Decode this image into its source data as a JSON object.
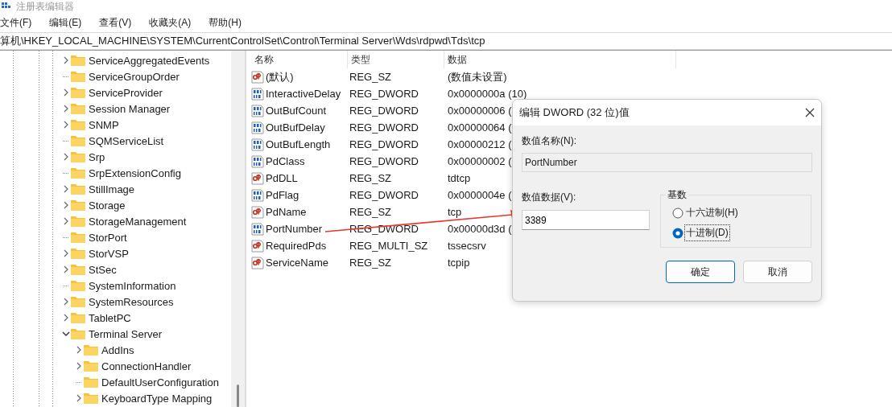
{
  "window": {
    "title": "注册表编辑器"
  },
  "menu": [
    "文件(F)",
    "编辑(E)",
    "查看(V)",
    "收藏夹(A)",
    "帮助(H)"
  ],
  "address": "算机\\HKEY_LOCAL_MACHINE\\SYSTEM\\CurrentControlSet\\Control\\Terminal Server\\Wds\\rdpwd\\Tds\\tcp",
  "tree": [
    {
      "label": "ServiceAggregatedEvents",
      "has_subkeys": true,
      "expanded": false
    },
    {
      "label": "ServiceGroupOrder",
      "has_subkeys": false
    },
    {
      "label": "ServiceProvider",
      "has_subkeys": true,
      "expanded": false
    },
    {
      "label": "Session Manager",
      "has_subkeys": true,
      "expanded": false
    },
    {
      "label": "SNMP",
      "has_subkeys": true,
      "expanded": false
    },
    {
      "label": "SQMServiceList",
      "has_subkeys": false
    },
    {
      "label": "Srp",
      "has_subkeys": true,
      "expanded": false
    },
    {
      "label": "SrpExtensionConfig",
      "has_subkeys": false
    },
    {
      "label": "StillImage",
      "has_subkeys": true,
      "expanded": false
    },
    {
      "label": "Storage",
      "has_subkeys": true,
      "expanded": false
    },
    {
      "label": "StorageManagement",
      "has_subkeys": true,
      "expanded": false
    },
    {
      "label": "StorPort",
      "has_subkeys": false
    },
    {
      "label": "StorVSP",
      "has_subkeys": true,
      "expanded": false
    },
    {
      "label": "StSec",
      "has_subkeys": true,
      "expanded": false
    },
    {
      "label": "SystemInformation",
      "has_subkeys": false
    },
    {
      "label": "SystemResources",
      "has_subkeys": true,
      "expanded": false
    },
    {
      "label": "TabletPC",
      "has_subkeys": true,
      "expanded": false
    },
    {
      "label": "Terminal Server",
      "has_subkeys": true,
      "expanded": true,
      "children": [
        {
          "label": "AddIns",
          "has_subkeys": true,
          "expanded": false
        },
        {
          "label": "ConnectionHandler",
          "has_subkeys": true,
          "expanded": false
        },
        {
          "label": "DefaultUserConfiguration",
          "has_subkeys": false
        },
        {
          "label": "KeyboardType Mapping",
          "has_subkeys": true,
          "expanded": false
        }
      ]
    }
  ],
  "values": {
    "columns": [
      "名称",
      "类型",
      "数据"
    ],
    "rows": [
      {
        "kind": "string",
        "name": "(默认)",
        "type": "REG_SZ",
        "data": "(数值未设置)"
      },
      {
        "kind": "binary",
        "name": "InteractiveDelay",
        "type": "REG_DWORD",
        "data": "0x0000000a (10)"
      },
      {
        "kind": "binary",
        "name": "OutBufCount",
        "type": "REG_DWORD",
        "data": "0x00000006 ("
      },
      {
        "kind": "binary",
        "name": "OutBufDelay",
        "type": "REG_DWORD",
        "data": "0x00000064 ("
      },
      {
        "kind": "binary",
        "name": "OutBufLength",
        "type": "REG_DWORD",
        "data": "0x00000212 ("
      },
      {
        "kind": "binary",
        "name": "PdClass",
        "type": "REG_DWORD",
        "data": "0x00000002 ("
      },
      {
        "kind": "string",
        "name": "PdDLL",
        "type": "REG_SZ",
        "data": "tdtcp"
      },
      {
        "kind": "binary",
        "name": "PdFlag",
        "type": "REG_DWORD",
        "data": "0x0000004e ("
      },
      {
        "kind": "string",
        "name": "PdName",
        "type": "REG_SZ",
        "data": "tcp"
      },
      {
        "kind": "binary",
        "name": "PortNumber",
        "type": "REG_DWORD",
        "data": "0x00000d3d ("
      },
      {
        "kind": "string",
        "name": "RequiredPds",
        "type": "REG_MULTI_SZ",
        "data": "tssecsrv"
      },
      {
        "kind": "string",
        "name": "ServiceName",
        "type": "REG_SZ",
        "data": "tcpip"
      }
    ]
  },
  "dialog": {
    "title": "编辑 DWORD (32 位)值",
    "name_label": "数值名称(N):",
    "name_value": "PortNumber",
    "data_label": "数值数据(V):",
    "data_value": "3389",
    "radix": {
      "label": "基数",
      "options": [
        {
          "label": "十六进制(H)",
          "selected": false
        },
        {
          "label": "十进制(D)",
          "selected": true
        }
      ]
    },
    "buttons": [
      {
        "label": "确定",
        "default": true
      },
      {
        "label": "取消",
        "default": false
      }
    ]
  }
}
